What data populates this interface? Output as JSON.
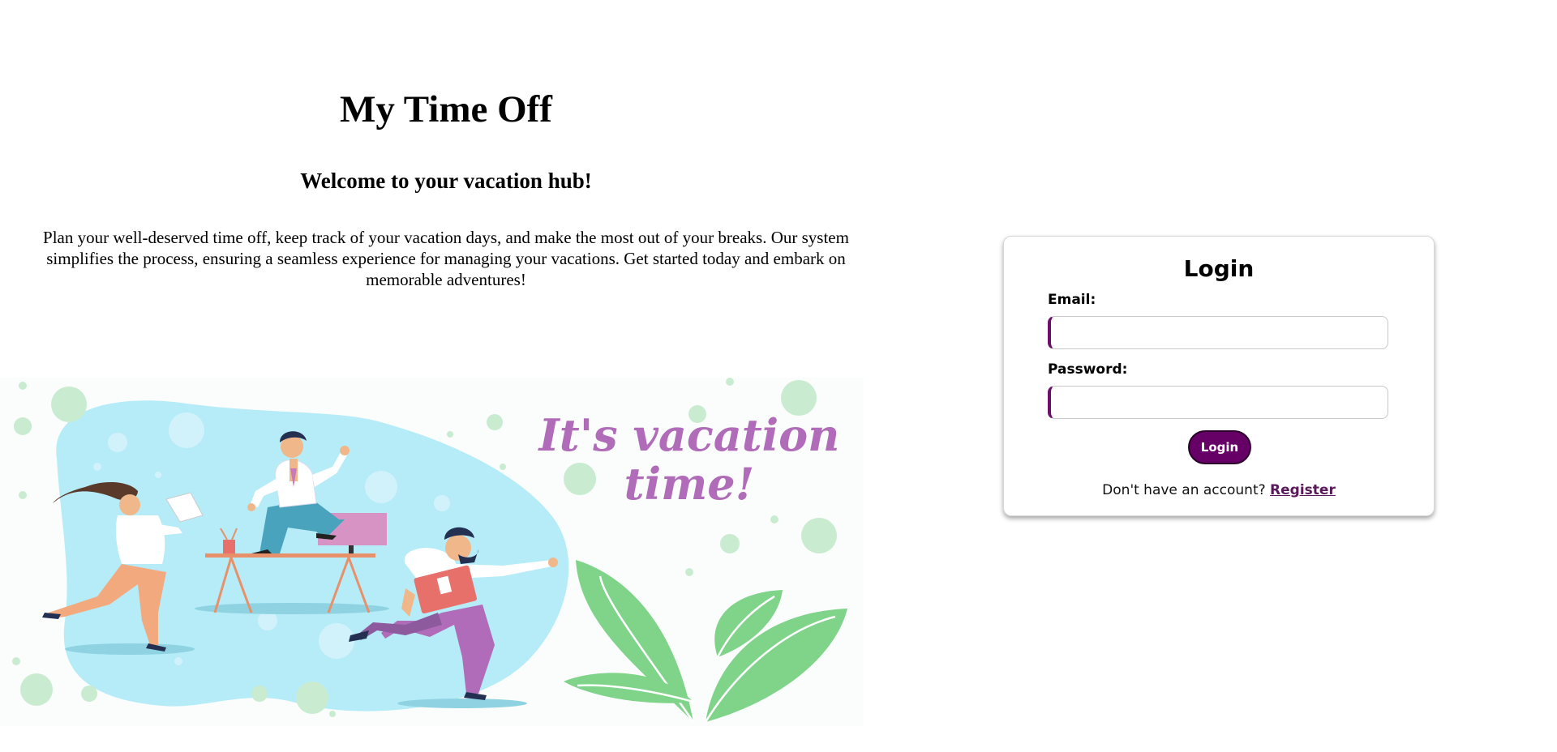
{
  "hero": {
    "title": "My Time Off",
    "subtitle": "Welcome to your vacation hub!",
    "description": "Plan your well-deserved time off, keep track of your vacation days, and make the most out of your breaks. Our system simplifies the process, ensuring a seamless experience for managing your vacations. Get started today and embark on memorable adventures!",
    "illustration_text_line1": "It's vacation",
    "illustration_text_line2": "time!"
  },
  "login": {
    "heading": "Login",
    "email_label": "Email:",
    "email_value": "",
    "password_label": "Password:",
    "password_value": "",
    "button_label": "Login",
    "register_prompt": "Don't have an account?",
    "register_link": "Register"
  },
  "colors": {
    "accent": "#660066",
    "illustration_blob": "#b5ecf8",
    "illustration_text": "#b06cb8",
    "leaf": "#7fd48a"
  }
}
